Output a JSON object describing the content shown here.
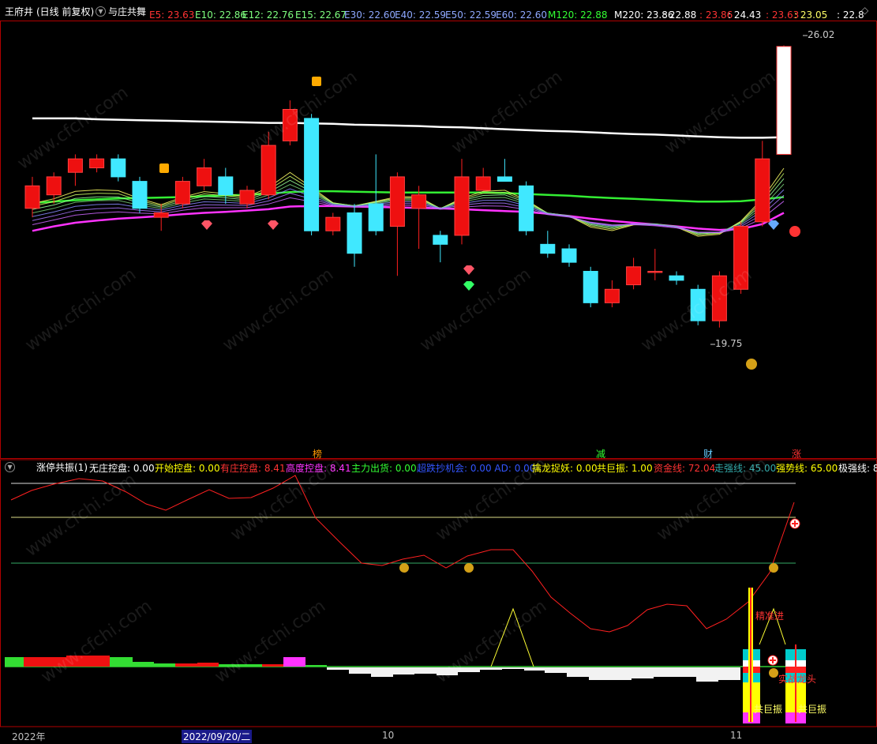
{
  "header": {
    "stock": "王府井",
    "period": "(日线 前复权)",
    "indicator": "与庄共舞",
    "ma": [
      {
        "label": "E5: 23.63",
        "color": "#ff3333"
      },
      {
        "label": "E10: 22.86",
        "color": "#7fff7f"
      },
      {
        "label": "E12: 22.76",
        "color": "#7fff7f"
      },
      {
        "label": "E15: 22.67",
        "color": "#7fff7f"
      },
      {
        "label": "E30: 22.60",
        "color": "#8ea8ff"
      },
      {
        "label": "E40: 22.59",
        "color": "#8ea8ff"
      },
      {
        "label": "E50: 22.59",
        "color": "#8ea8ff"
      },
      {
        "label": "E60: 22.60",
        "color": "#8ea8ff"
      },
      {
        "label": "M120: 22.88",
        "color": "#33ff33"
      },
      {
        "label": "M220: 23.86",
        "color": "#ffffff"
      },
      {
        "label": ": 22.88",
        "color": "#ffffff"
      },
      {
        "label": ": 23.86",
        "color": "#ff3333"
      },
      {
        "label": ": 24.43",
        "color": "#ffffff"
      },
      {
        "label": ": 23.63",
        "color": "#ff3333"
      },
      {
        "label": ": 23.05",
        "color": "#ffff66"
      },
      {
        "label": ": 22.8",
        "color": "#ffffff"
      }
    ]
  },
  "price_labels": {
    "high": "26.02",
    "low": "19.75"
  },
  "flags": [
    {
      "text": "榜",
      "color": "#ff9900"
    },
    {
      "text": "减",
      "color": "#33ff33"
    },
    {
      "text": "财",
      "color": "#66ccff"
    },
    {
      "text": "涨",
      "color": "#ff3333"
    }
  ],
  "indicator_header": {
    "name": "涨停共振(1)",
    "items": [
      {
        "label": "无庄控盘: 0.00",
        "color": "#ffffff"
      },
      {
        "label": "开始控盘: 0.00",
        "color": "#ffff00"
      },
      {
        "label": "有庄控盘: 8.41",
        "color": "#ff3333"
      },
      {
        "label": "高度控盘: 8.41",
        "color": "#ff33ff"
      },
      {
        "label": "主力出货: 0.00",
        "color": "#33ff33"
      },
      {
        "label": "超跌抄机会: 0.00 AD: 0.00",
        "color": "#3355ff"
      },
      {
        "label": "擒龙捉妖: 0.00",
        "color": "#ffff00"
      },
      {
        "label": "共巨振: 1.00",
        "color": "#ffff00"
      },
      {
        "label": "资金线: 72.04",
        "color": "#ff3333"
      },
      {
        "label": "走强线: 45.00",
        "color": "#33aaaa"
      },
      {
        "label": "强势线: 65.00",
        "color": "#ffff00"
      },
      {
        "label": "极强线: 8",
        "color": "#ffffff"
      }
    ]
  },
  "indicator_labels": {
    "bulk1": "共巨振",
    "bulk2": "共巨振",
    "entry": "精准进",
    "mountain": "实战龙头"
  },
  "xaxis": {
    "year": "2022年",
    "cursor": "2022/09/20/二",
    "oct": "10",
    "nov": "11"
  },
  "watermark": "www.cfchi.com",
  "chart_data": {
    "type": "candlestick",
    "y_range": [
      19.2,
      26.4
    ],
    "candles": [
      {
        "o": 22.4,
        "c": 22.9,
        "h": 23.1,
        "l": 22.2
      },
      {
        "o": 22.7,
        "c": 23.1,
        "h": 23.2,
        "l": 22.5
      },
      {
        "o": 23.2,
        "c": 23.5,
        "h": 23.6,
        "l": 22.9
      },
      {
        "o": 23.3,
        "c": 23.5,
        "h": 23.6,
        "l": 23.2
      },
      {
        "o": 23.5,
        "c": 23.1,
        "h": 23.6,
        "l": 23.0
      },
      {
        "o": 23.0,
        "c": 22.4,
        "h": 23.1,
        "l": 22.3
      },
      {
        "o": 22.2,
        "c": 22.3,
        "h": 22.5,
        "l": 21.9
      },
      {
        "o": 22.5,
        "c": 23.0,
        "h": 23.1,
        "l": 22.4
      },
      {
        "o": 22.9,
        "c": 23.3,
        "h": 23.5,
        "l": 22.8
      },
      {
        "o": 23.1,
        "c": 22.7,
        "h": 23.3,
        "l": 22.5
      },
      {
        "o": 22.5,
        "c": 22.8,
        "h": 22.9,
        "l": 22.4
      },
      {
        "o": 22.7,
        "c": 23.8,
        "h": 24.1,
        "l": 22.6
      },
      {
        "o": 23.9,
        "c": 24.6,
        "h": 24.8,
        "l": 23.8
      },
      {
        "o": 24.4,
        "c": 21.9,
        "h": 24.5,
        "l": 21.8
      },
      {
        "o": 21.9,
        "c": 22.2,
        "h": 22.3,
        "l": 21.8
      },
      {
        "o": 22.3,
        "c": 21.4,
        "h": 22.5,
        "l": 21.1
      },
      {
        "o": 22.5,
        "c": 21.9,
        "h": 23.6,
        "l": 21.8
      },
      {
        "o": 22.0,
        "c": 23.1,
        "h": 23.2,
        "l": 20.9
      },
      {
        "o": 22.4,
        "c": 22.7,
        "h": 22.9,
        "l": 21.5
      },
      {
        "o": 21.8,
        "c": 21.6,
        "h": 21.9,
        "l": 21.2
      },
      {
        "o": 21.8,
        "c": 23.1,
        "h": 23.5,
        "l": 21.6
      },
      {
        "o": 22.8,
        "c": 23.1,
        "h": 23.3,
        "l": 22.8
      },
      {
        "o": 23.1,
        "c": 23.0,
        "h": 23.5,
        "l": 23.0
      },
      {
        "o": 22.9,
        "c": 21.9,
        "h": 23.0,
        "l": 21.8
      },
      {
        "o": 21.6,
        "c": 21.4,
        "h": 21.9,
        "l": 21.3
      },
      {
        "o": 21.5,
        "c": 21.2,
        "h": 21.6,
        "l": 21.1
      },
      {
        "o": 21.0,
        "c": 20.3,
        "h": 21.1,
        "l": 20.2
      },
      {
        "o": 20.3,
        "c": 20.6,
        "h": 20.8,
        "l": 20.2
      },
      {
        "o": 20.7,
        "c": 21.1,
        "h": 21.3,
        "l": 20.6
      },
      {
        "o": 21.0,
        "c": 21.0,
        "h": 21.5,
        "l": 20.8
      },
      {
        "o": 20.9,
        "c": 20.8,
        "h": 21.0,
        "l": 20.7
      },
      {
        "o": 20.6,
        "c": 19.9,
        "h": 20.7,
        "l": 19.8
      },
      {
        "o": 19.9,
        "c": 20.9,
        "h": 21.0,
        "l": 19.75
      },
      {
        "o": 20.6,
        "c": 22.0,
        "h": 22.1,
        "l": 20.5
      },
      {
        "o": 22.1,
        "c": 23.5,
        "h": 23.9,
        "l": 22.0
      },
      {
        "o": 23.6,
        "c": 26.0,
        "h": 26.02,
        "l": 23.6
      }
    ],
    "lines": [
      {
        "name": "M220",
        "color": "#ffffff",
        "values": [
          24.4,
          24.4,
          24.4,
          24.38,
          24.37,
          24.36,
          24.35,
          24.34,
          24.33,
          24.32,
          24.31,
          24.3,
          24.3,
          24.29,
          24.28,
          24.26,
          24.25,
          24.24,
          24.23,
          24.21,
          24.2,
          24.18,
          24.16,
          24.14,
          24.12,
          24.11,
          24.09,
          24.07,
          24.05,
          24.04,
          24.02,
          24.0,
          23.98,
          23.97,
          23.97,
          23.98
        ]
      },
      {
        "name": "M120",
        "color": "#33ee33",
        "values": [
          22.52,
          22.55,
          22.58,
          22.6,
          22.62,
          22.63,
          22.64,
          22.65,
          22.67,
          22.69,
          22.7,
          22.73,
          22.76,
          22.78,
          22.78,
          22.77,
          22.76,
          22.75,
          22.75,
          22.75,
          22.75,
          22.75,
          22.74,
          22.72,
          22.7,
          22.68,
          22.65,
          22.63,
          22.61,
          22.59,
          22.57,
          22.55,
          22.55,
          22.56,
          22.6,
          22.65
        ]
      },
      {
        "name": "E60",
        "color": "#ff33ff",
        "values": [
          21.9,
          22.0,
          22.08,
          22.13,
          22.17,
          22.2,
          22.23,
          22.27,
          22.3,
          22.32,
          22.35,
          22.38,
          22.44,
          22.45,
          22.45,
          22.44,
          22.43,
          22.42,
          22.41,
          22.4,
          22.38,
          22.36,
          22.34,
          22.32,
          22.28,
          22.23,
          22.17,
          22.12,
          22.08,
          22.04,
          22.0,
          21.95,
          21.92,
          21.94,
          22.05,
          22.3
        ]
      }
    ]
  }
}
